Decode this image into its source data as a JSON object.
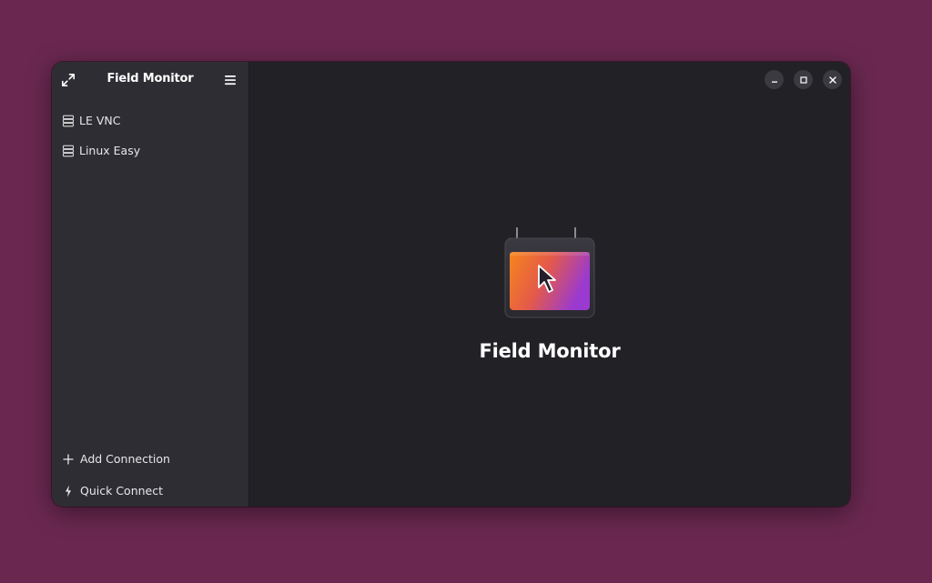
{
  "sidebar": {
    "title": "Field Monitor",
    "header_left_icon": "fullscreen-icon",
    "header_right_icon": "hamburger-menu-icon",
    "connections": [
      {
        "label": "LE VNC",
        "icon": "server-icon"
      },
      {
        "label": "Linux Easy",
        "icon": "server-icon"
      }
    ],
    "footer": {
      "add_connection": {
        "label": "Add Connection",
        "icon": "plus-icon"
      },
      "quick_connect": {
        "label": "Quick Connect",
        "icon": "lightning-icon"
      }
    }
  },
  "main": {
    "status_title": "Field Monitor",
    "logo_icon": "field-monitor-app-icon"
  },
  "window_controls": [
    "minimize-icon",
    "maximize-icon",
    "close-icon"
  ],
  "colors": {
    "desktop_background": "#6a2850",
    "sidebar_background": "#2e2d33",
    "content_background": "#222126",
    "logo_gradient_start": "#f7851a",
    "logo_gradient_end": "#9a3ad0"
  }
}
